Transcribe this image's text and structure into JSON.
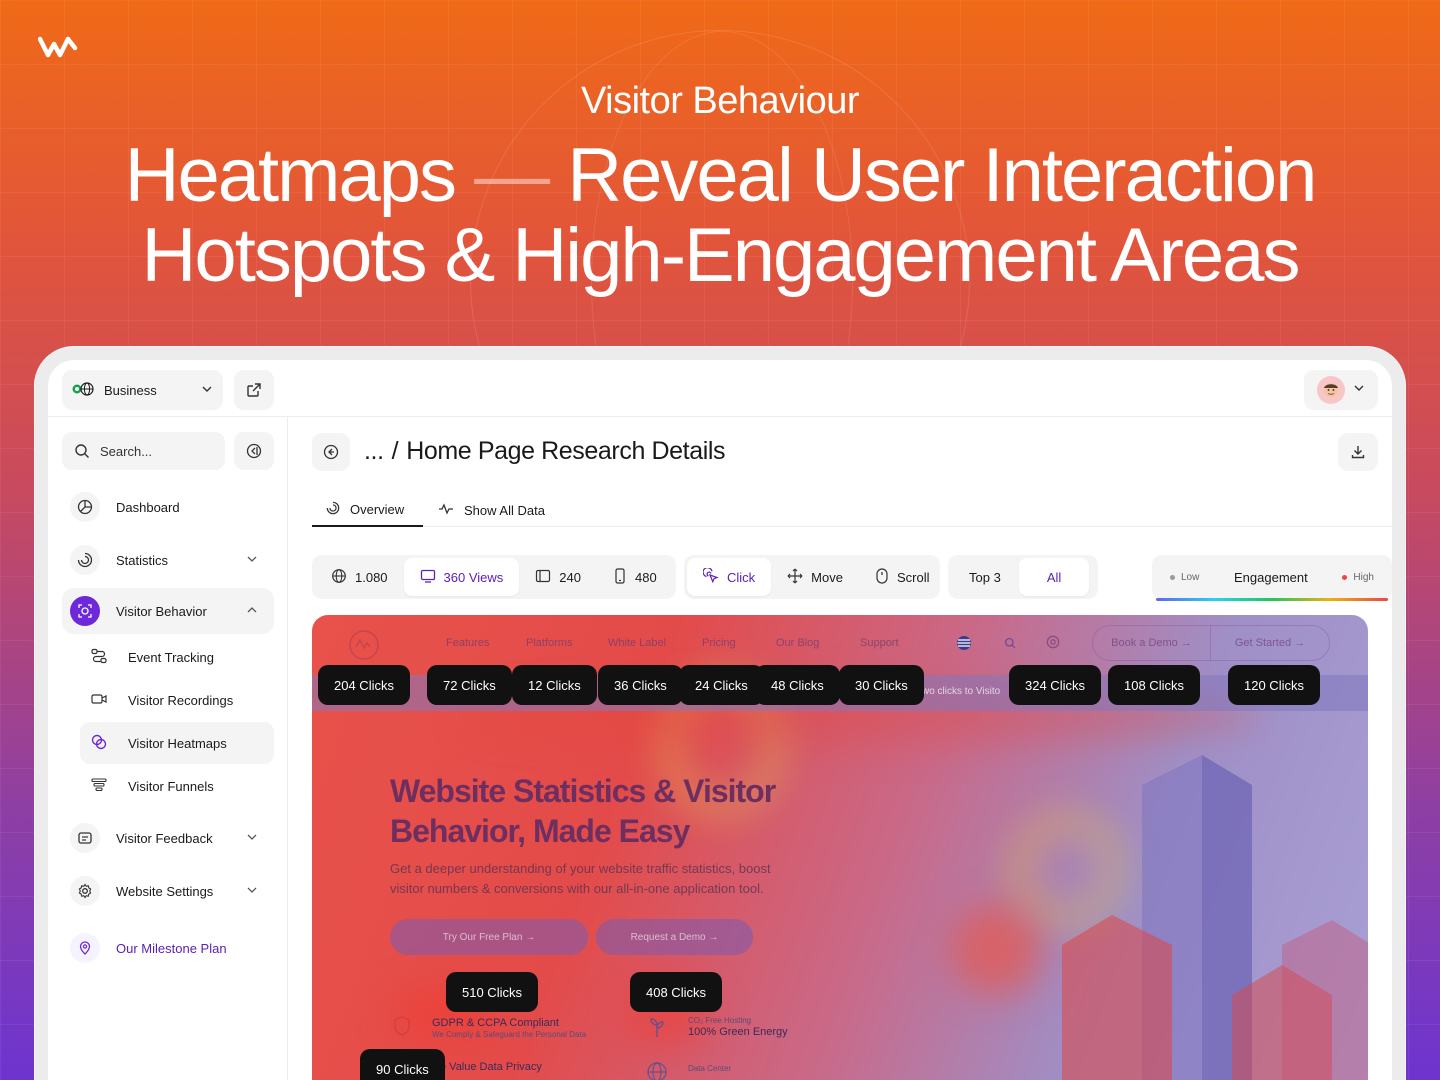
{
  "hero": {
    "kicker": "Visitor Behaviour",
    "title_line1_a": "Heatmaps",
    "title_dash": "—",
    "title_line1_b": "Reveal User Interaction",
    "title_line2": "Hotspots & High-Engagement Areas"
  },
  "topbar": {
    "workspace": "Business"
  },
  "sidebar": {
    "search_placeholder": "Search...",
    "items": [
      {
        "label": "Dashboard",
        "icon": "dashboard-icon"
      },
      {
        "label": "Statistics",
        "icon": "statistics-icon"
      },
      {
        "label": "Visitor Behavior",
        "icon": "visitor-behavior-icon"
      },
      {
        "label": "Visitor Feedback",
        "icon": "feedback-icon"
      },
      {
        "label": "Website Settings",
        "icon": "gear-icon"
      },
      {
        "label": "Our Milestone Plan",
        "icon": "milestone-icon"
      }
    ],
    "sub_items": [
      {
        "label": "Event Tracking",
        "icon": "event-tracking-icon"
      },
      {
        "label": "Visitor Recordings",
        "icon": "recordings-icon"
      },
      {
        "label": "Visitor Heatmaps",
        "icon": "heatmaps-icon"
      },
      {
        "label": "Visitor Funnels",
        "icon": "funnels-icon"
      }
    ]
  },
  "main": {
    "breadcrumb_ellipsis": "...",
    "breadcrumb_sep": "/",
    "page_title": "Home Page Research Details",
    "tabs": [
      "Overview",
      "Show All Data"
    ]
  },
  "toolbar": {
    "devices": [
      {
        "label": "1.080",
        "icon": "globe-icon"
      },
      {
        "label": "360 Views",
        "icon": "desktop-icon"
      },
      {
        "label": "240",
        "icon": "tablet-icon"
      },
      {
        "label": "480",
        "icon": "mobile-icon"
      }
    ],
    "modes": [
      {
        "label": "Click",
        "icon": "click-icon"
      },
      {
        "label": "Move",
        "icon": "move-icon"
      },
      {
        "label": "Scroll",
        "icon": "mouse-icon"
      }
    ],
    "filters": [
      "Top 3",
      "All"
    ],
    "legend": {
      "low": "Low",
      "title": "Engagement",
      "high": "High"
    }
  },
  "heatmap": {
    "nav_links": [
      "Features",
      "Platforms",
      "White Label",
      "Pricing",
      "Our Blog",
      "Support"
    ],
    "demo_button": "Book a Demo →",
    "start_button": "Get Started →",
    "banner_text": "wo clicks to Visito",
    "clicks": [
      "204 Clicks",
      "72 Clicks",
      "12 Clicks",
      "36 Clicks",
      "24 Clicks",
      "48 Clicks",
      "30 Clicks",
      "324 Clicks",
      "108 Clicks",
      "120 Clicks",
      "510 Clicks",
      "408 Clicks",
      "90 Clicks"
    ],
    "headline": "Website Statistics & Visitor Behavior, Made Easy",
    "subtext": "Get a deeper understanding of your website traffic statistics, boost visitor numbers & conversions with our all-in-one application tool.",
    "cta_primary": "Try Our Free Plan →",
    "cta_secondary": "Request a Demo →",
    "features": [
      {
        "title": "GDPR & CCPA Compliant",
        "desc": "We Comply & Safeguard the Personal Data"
      },
      {
        "title": "100% Green Energy",
        "desc": "CO₂ Free Hosting"
      },
      {
        "title": "e Value Data Privacy",
        "desc": ""
      },
      {
        "title": "",
        "desc": "Data Center"
      }
    ]
  }
}
